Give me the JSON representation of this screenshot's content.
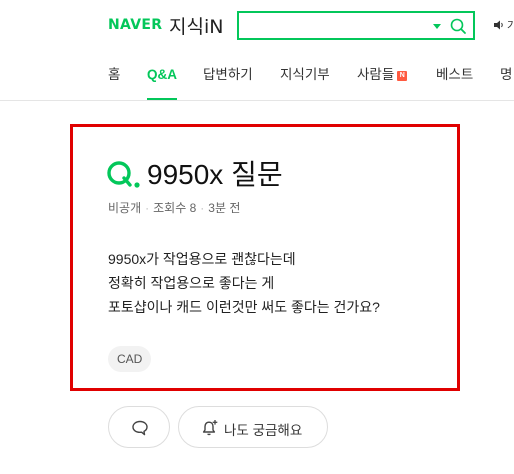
{
  "header": {
    "logo_naver": "NAVER",
    "logo_kin": "지식iN",
    "search": {
      "value": "",
      "placeholder": ""
    },
    "right_text": "가"
  },
  "nav": {
    "tabs": [
      {
        "label": "홈",
        "active": false
      },
      {
        "label": "Q&A",
        "active": true
      },
      {
        "label": "답변하기",
        "active": false
      },
      {
        "label": "지식기부",
        "active": false
      },
      {
        "label": "사람들",
        "active": false,
        "badge": "N"
      },
      {
        "label": "베스트",
        "active": false
      },
      {
        "label": "명",
        "active": false
      }
    ]
  },
  "question": {
    "title": "9950x 질문",
    "meta": {
      "privacy": "비공개",
      "views": "조회수 8",
      "time": "3분 전"
    },
    "body_lines": [
      "9950x가 작업용으로 괜찮다는데",
      "정확히 작업용으로 좋다는 게",
      "포토샵이나 캐드 이런것만 써도 좋다는 건가요?"
    ],
    "tag": "CAD"
  },
  "actions": {
    "curious_label": "나도 궁금해요"
  },
  "colors": {
    "brand": "#03c75a",
    "highlight_box": "#e00000",
    "badge": "#ff5a40"
  },
  "icons": [
    "search-icon",
    "speaker-icon",
    "q-mark-icon",
    "speech-bubble-icon",
    "bell-plus-icon"
  ]
}
